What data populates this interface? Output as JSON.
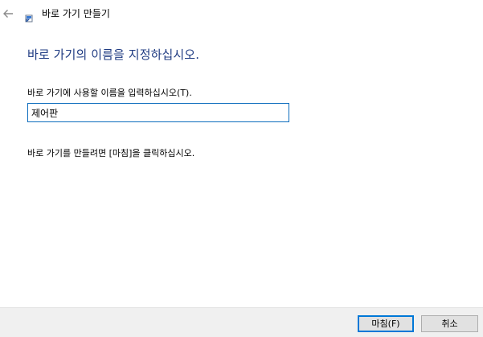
{
  "header": {
    "title": "바로 가기 만들기",
    "back_icon": "back-arrow-icon",
    "app_icon": "shortcut-icon"
  },
  "main": {
    "heading": "바로 가기의 이름을 지정하십시오.",
    "name_label": "바로 가기에 사용할 이름을 입력하십시오(T).",
    "name_value": "제어판",
    "instruction": "바로 가기를 만들려면 [마침]을 클릭하십시오."
  },
  "footer": {
    "finish_label": "마침(F)",
    "cancel_label": "취소"
  },
  "colors": {
    "heading": "#1f3b82",
    "input_border": "#0c6cbd",
    "footer_bg": "#f0f0f0",
    "default_button_border": "#0078d7"
  }
}
